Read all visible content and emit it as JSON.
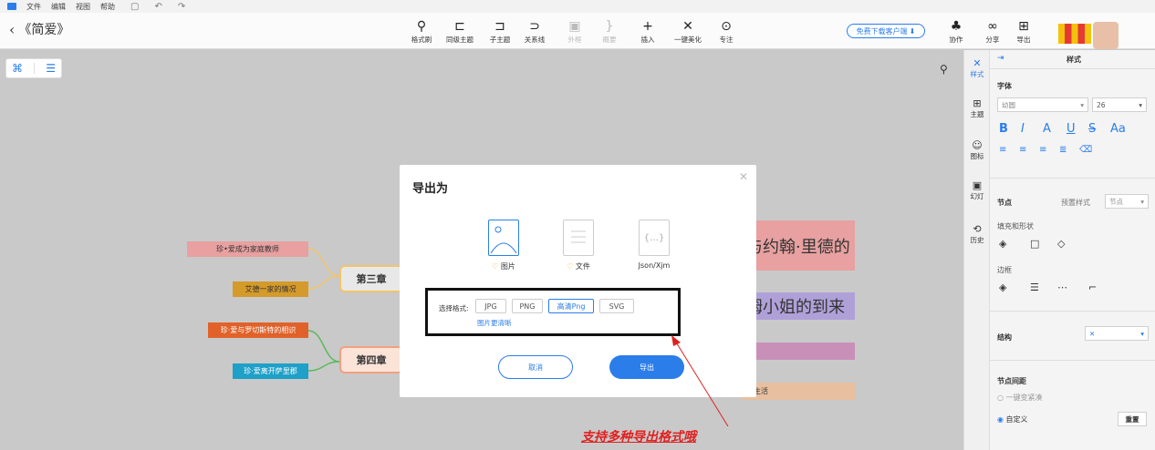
{
  "menu": [
    "文件",
    "编辑",
    "视图",
    "帮助"
  ],
  "quick_icons": [
    "save-icon",
    "undo-icon",
    "redo-icon"
  ],
  "document": {
    "back_label": "《简爱》"
  },
  "toolbar": {
    "buttons": [
      {
        "label": "格式刷",
        "icon": "format-brush-icon",
        "enabled": true
      },
      {
        "label": "同级主题",
        "icon": "sibling-topic-icon",
        "enabled": true
      },
      {
        "label": "子主题",
        "icon": "subtopic-icon",
        "enabled": true
      },
      {
        "label": "关系线",
        "icon": "relation-line-icon",
        "enabled": true
      },
      {
        "label": "外框",
        "icon": "boundary-icon",
        "enabled": false
      },
      {
        "label": "概要",
        "icon": "summary-icon",
        "enabled": false
      },
      {
        "label": "插入",
        "icon": "insert-icon",
        "enabled": true
      },
      {
        "label": "一键美化",
        "icon": "beautify-icon",
        "enabled": true
      },
      {
        "label": "专注",
        "icon": "focus-icon",
        "enabled": true
      }
    ],
    "download_label": "免费下载客户端",
    "right_buttons": [
      {
        "label": "协作",
        "icon": "collaborate-icon"
      },
      {
        "label": "分享",
        "icon": "share-icon"
      },
      {
        "label": "导出",
        "icon": "export-icon"
      }
    ]
  },
  "mindmap": {
    "chapters": [
      {
        "label": "第三章",
        "color": "#f2c46b"
      },
      {
        "label": "第四章",
        "color": "#f0a080"
      }
    ],
    "leaves": [
      {
        "label": "珍•爱成为家庭教师",
        "bg": "#e8a0a0"
      },
      {
        "label": "艾德一家的情况",
        "bg": "#d49a2a"
      },
      {
        "label": "珍·爱与罗切斯特的相识",
        "bg": "#e0622a"
      },
      {
        "label": "珍·爱离开萨里郡",
        "bg": "#1ea0c8"
      }
    ],
    "right_nodes": [
      {
        "label": "与约翰·里德的",
        "bg": "#e8a0a0"
      },
      {
        "label": "姆小姐的到来",
        "bg": "#b0a0d8"
      },
      {
        "label": "",
        "bg": "#c890b8"
      },
      {
        "label": "生活",
        "bg": "#e8c0a0"
      }
    ]
  },
  "sidebar_tabs": [
    {
      "label": "样式",
      "icon": "style-icon",
      "active": true
    },
    {
      "label": "主题",
      "icon": "theme-icon",
      "active": false
    },
    {
      "label": "图标",
      "icon": "icons-icon",
      "active": false
    },
    {
      "label": "幻灯",
      "icon": "slides-icon",
      "active": false
    },
    {
      "label": "历史",
      "icon": "history-icon",
      "active": false
    }
  ],
  "style_panel": {
    "title": "样式",
    "font_section": "字体",
    "font_name": "幼圆",
    "font_size": "26",
    "node_section": "节点",
    "preset_label": "预置样式",
    "preset_value": "节点",
    "fill_label": "填充和形状",
    "border_label": "边框",
    "structure_label": "结构",
    "spacing_label": "节点间距",
    "compact_option": "一键变紧凑",
    "custom_option": "自定义",
    "reset_label": "重置"
  },
  "dialog": {
    "title": "导出为",
    "types": [
      {
        "label": "图片",
        "selected": true,
        "pro": true
      },
      {
        "label": "文件",
        "selected": false,
        "pro": true
      },
      {
        "label": "Json/Xjm",
        "selected": false,
        "pro": false
      }
    ],
    "format_label": "选择格式:",
    "formats": [
      {
        "label": "JPG",
        "selected": false
      },
      {
        "label": "PNG",
        "selected": false
      },
      {
        "label": "高清Png",
        "selected": true
      },
      {
        "label": "SVG",
        "selected": false
      }
    ],
    "clarity_link": "图片更清晰",
    "cancel": "取消",
    "export": "导出"
  },
  "annotation": "支持多种导出格式哦"
}
